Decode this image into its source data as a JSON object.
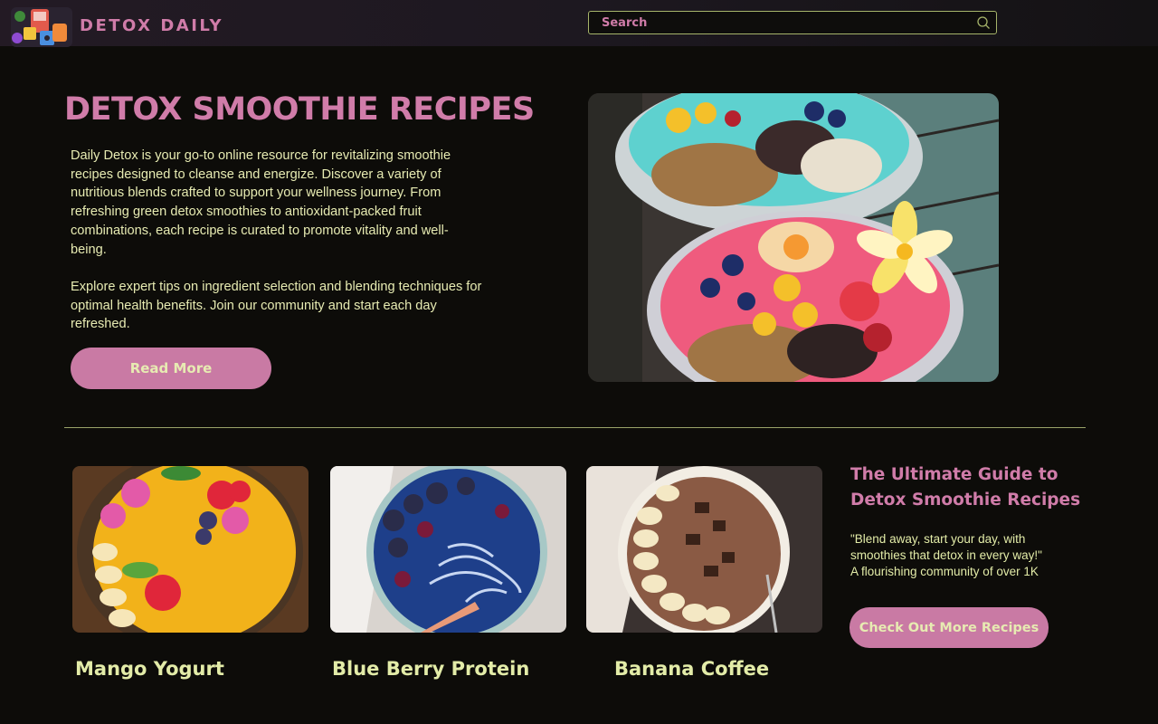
{
  "header": {
    "brand": "DETOX DAILY",
    "search_placeholder": "Search"
  },
  "hero": {
    "title": "DETOX SMOOTHIE RECIPES",
    "paragraph1": "Daily Detox is your go-to online resource for revitalizing smoothie recipes designed to cleanse and energize. Discover a variety of nutritious blends crafted to support your wellness journey. From refreshing green detox smoothies to antioxidant-packed fruit combinations, each recipe is curated to promote vitality and well-being.",
    "paragraph2": "Explore expert tips on ingredient selection and blending techniques for optimal health benefits. Join our community and start each day refreshed.",
    "read_more_label": "Read More"
  },
  "cards": [
    {
      "title": "Mango Yogurt"
    },
    {
      "title": "Blue Berry Protein"
    },
    {
      "title": "Banana Coffee"
    }
  ],
  "guide": {
    "title_line1": "The Ultimate Guide to",
    "title_line2": "Detox Smoothie Recipes",
    "quote_line1": "\"Blend away, start your day, with",
    "quote_line2": "smoothies that detox in every way!\"",
    "quote_line3": "A flourishing community of over 1K",
    "button_label": "Check Out More Recipes"
  },
  "colors": {
    "accent_pink": "#d07ca9",
    "text_lime": "#e3eca8",
    "background": "#0d0c09"
  }
}
